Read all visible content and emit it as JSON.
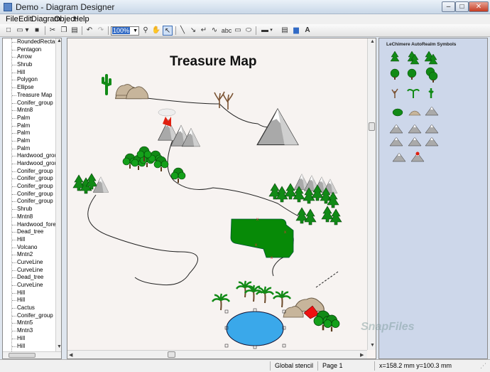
{
  "window": {
    "title": "Demo - Diagram Designer",
    "minimize_glyph": "–",
    "maximize_glyph": "□",
    "close_glyph": "✕"
  },
  "menu": [
    "File",
    "Edit",
    "Diagram",
    "Object",
    "Help"
  ],
  "toolbar": {
    "zoom_value": "100%",
    "text_tool_label": "abc"
  },
  "tree_items": [
    "RoundedRectangle",
    "Pentagon",
    "Arrow",
    "Shrub",
    "Hill",
    "Polygon",
    "Ellipse",
    "Treasure Map",
    "Conifer_group",
    "Mntn8",
    "Palm",
    "Palm",
    "Palm",
    "Palm",
    "Palm",
    "Hardwood_group",
    "Hardwood_group",
    "Conifer_group",
    "Conifer_group",
    "Conifer_group",
    "Conifer_group",
    "Conifer_group",
    "Shrub",
    "Mntn8",
    "Hardwood_forest",
    "Dead_tree",
    "Hill",
    "Volcano",
    "Mntn2",
    "CurveLine",
    "CurveLine",
    "Dead_tree",
    "CurveLine",
    "Hill",
    "Hill",
    "Cactus",
    "Conifer_group",
    "Mntn5",
    "Mntn3",
    "Hill",
    "Hill"
  ],
  "canvas": {
    "title": "Treasure Map"
  },
  "symbols_panel": {
    "title": "LeChimere AutoRealm Symbols"
  },
  "status": {
    "stencil": "Global stencil",
    "page": "Page 1",
    "coords": "x=158.2 mm  y=100.3 mm"
  },
  "watermark": "SnapFiles",
  "colors": {
    "accent": "#316ac5",
    "symbols_bg": "#cdd7ea",
    "canvas_bg": "#f7f3f1",
    "lake": "#3aa8ea",
    "field": "#078a07",
    "tree": "#118a16"
  }
}
